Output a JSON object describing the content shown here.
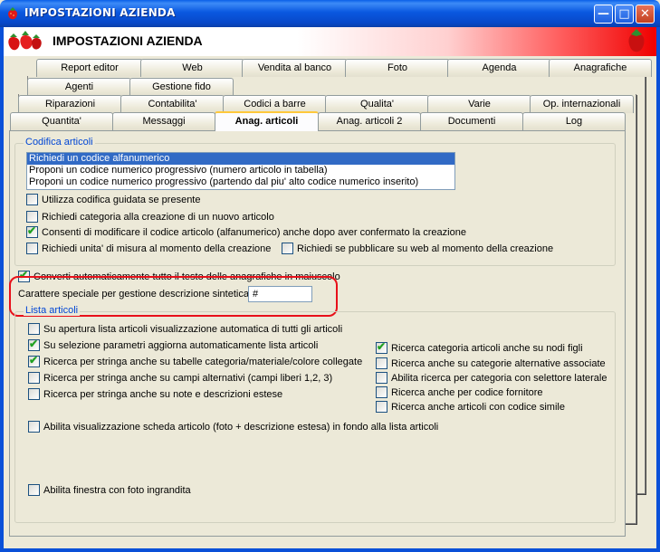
{
  "window": {
    "title": "IMPOSTAZIONI AZIENDA",
    "app_icon": "strawberry-icon"
  },
  "titlebar_buttons": {
    "minimize": "minimize-icon",
    "maximize": "maximize-icon",
    "close": "close-icon"
  },
  "banner": {
    "title": "IMPOSTAZIONI AZIENDA",
    "left_logo": "strawberries-logo",
    "right_logo": "strawberry-logo"
  },
  "tabs": {
    "row1": [
      "Report editor",
      "Web",
      "Vendita al banco",
      "Foto",
      "Agenda",
      "Anagrafiche"
    ],
    "row2": [
      "Agenti",
      "Gestione fido"
    ],
    "row3": [
      "Riparazioni",
      "Contabilita'",
      "Codici a barre",
      "Qualita'",
      "Varie",
      "Op. internazionali"
    ],
    "row4": [
      "Quantita'",
      "Messaggi",
      "Anag. articoli",
      "Anag. articoli 2",
      "Documenti",
      "Log"
    ],
    "active": "Anag. articoli"
  },
  "codifica": {
    "legend": "Codifica articoli",
    "options": [
      "Richiedi un codice alfanumerico",
      "Proponi un codice numerico progressivo (numero articolo in tabella)",
      "Proponi un codice numerico progressivo (partendo dal piu' alto codice numerico inserito)"
    ],
    "selected_index": 0,
    "checks": [
      {
        "label": "Utilizza codifica guidata se presente",
        "checked": false
      },
      {
        "label": "Richiedi categoria alla creazione di un nuovo articolo",
        "checked": false
      },
      {
        "label": "Consenti di modificare il codice articolo (alfanumerico) anche dopo aver confermato la creazione",
        "checked": true
      },
      {
        "label": "Richiedi unita' di misura al momento della creazione",
        "checked": false
      },
      {
        "label": "Richiedi se pubblicare su web al momento della creazione",
        "checked": false
      }
    ]
  },
  "converti": {
    "label": "Converti automaticamente tutto il testo delle anagrafiche in maiuscolo",
    "checked": true
  },
  "carattere": {
    "label": "Carattere speciale per gestione descrizione sintetica :",
    "value": "#"
  },
  "lista": {
    "legend": "Lista articoli",
    "left_checks": [
      {
        "label": "Su apertura lista articoli visualizzazione automatica di tutti gli articoli",
        "checked": false
      },
      {
        "label": "Su selezione parametri aggiorna automaticamente lista articoli",
        "checked": true
      },
      {
        "label": "Ricerca per stringa anche su tabelle categoria/materiale/colore collegate",
        "checked": true
      },
      {
        "label": "Ricerca per stringa anche su campi alternativi (campi liberi 1,2, 3)",
        "checked": false
      },
      {
        "label": "Ricerca per stringa anche su note e descrizioni estese",
        "checked": false
      }
    ],
    "right_checks": [
      {
        "label": "Ricerca categoria articoli anche su nodi figli",
        "checked": true
      },
      {
        "label": "Ricerca anche su categorie alternative associate",
        "checked": false
      },
      {
        "label": "Abilita ricerca per categoria con selettore laterale",
        "checked": false
      },
      {
        "label": "Ricerca anche per codice fornitore",
        "checked": false
      },
      {
        "label": "Ricerca anche articoli con codice simile",
        "checked": false
      }
    ],
    "scheda": {
      "label": "Abilita visualizzazione scheda articolo (foto + descrizione estesa) in fondo alla lista articoli",
      "checked": false
    },
    "finestra": {
      "label": "Abilita finestra con foto ingrandita",
      "checked": false
    }
  },
  "colors": {
    "titlebar": "#0a58e0",
    "legend": "#0046d5",
    "highlight": "#e8101a",
    "selection": "#316ac5"
  }
}
